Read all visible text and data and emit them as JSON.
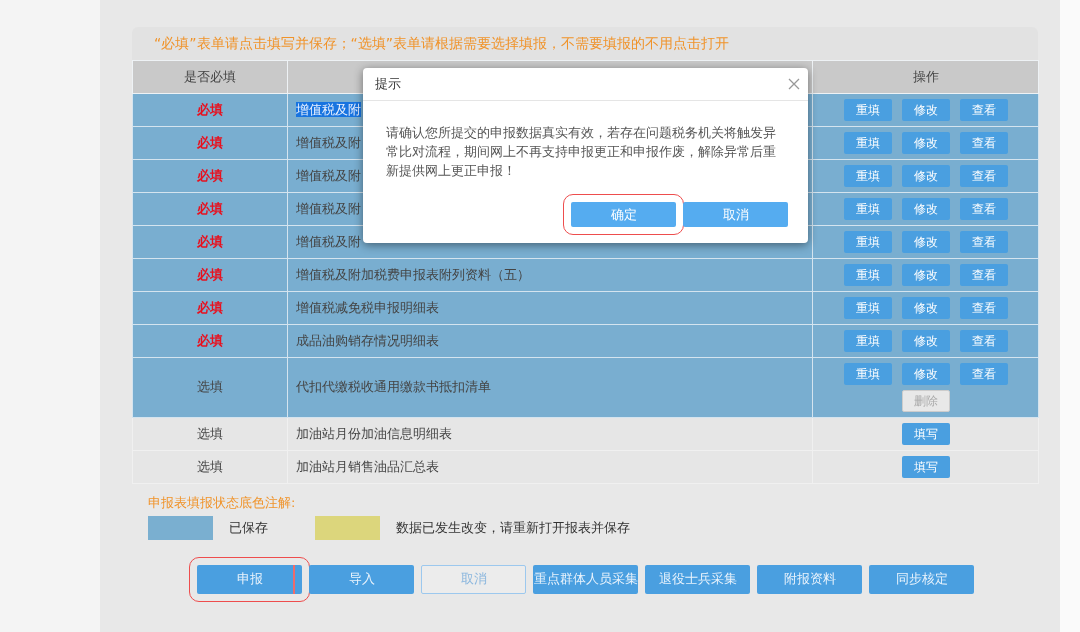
{
  "notice": "“必填”表单请点击填写并保存；“选填”表单请根据需要选择填报，不需要填报的不用点击打开",
  "table": {
    "header": {
      "column_1": "是否必填",
      "column_3": "操作"
    },
    "rows": [
      {
        "requirement": "必填",
        "kind": "required",
        "name": "增值税及附",
        "saved": true,
        "selected": true,
        "actions": [
          {
            "label": "重填",
            "disabled": false
          },
          {
            "label": "修改",
            "disabled": false
          },
          {
            "label": "查看",
            "disabled": false
          }
        ]
      },
      {
        "requirement": "必填",
        "kind": "required",
        "name": "增值税及附",
        "saved": true,
        "selected": false,
        "actions": [
          {
            "label": "重填",
            "disabled": false
          },
          {
            "label": "修改",
            "disabled": false
          },
          {
            "label": "查看",
            "disabled": false
          }
        ]
      },
      {
        "requirement": "必填",
        "kind": "required",
        "name": "增值税及附",
        "saved": true,
        "selected": false,
        "actions": [
          {
            "label": "重填",
            "disabled": false
          },
          {
            "label": "修改",
            "disabled": false
          },
          {
            "label": "查看",
            "disabled": false
          }
        ]
      },
      {
        "requirement": "必填",
        "kind": "required",
        "name": "增值税及附",
        "saved": true,
        "selected": false,
        "actions": [
          {
            "label": "重填",
            "disabled": false
          },
          {
            "label": "修改",
            "disabled": false
          },
          {
            "label": "查看",
            "disabled": false
          }
        ]
      },
      {
        "requirement": "必填",
        "kind": "required",
        "name": "增值税及附",
        "saved": true,
        "selected": false,
        "actions": [
          {
            "label": "重填",
            "disabled": false
          },
          {
            "label": "修改",
            "disabled": false
          },
          {
            "label": "查看",
            "disabled": false
          }
        ]
      },
      {
        "requirement": "必填",
        "kind": "required",
        "name": "增值税及附加税费申报表附列资料（五）",
        "saved": true,
        "selected": false,
        "actions": [
          {
            "label": "重填",
            "disabled": false
          },
          {
            "label": "修改",
            "disabled": false
          },
          {
            "label": "查看",
            "disabled": false
          }
        ]
      },
      {
        "requirement": "必填",
        "kind": "required",
        "name": "增值税减免税申报明细表",
        "saved": true,
        "selected": false,
        "actions": [
          {
            "label": "重填",
            "disabled": false
          },
          {
            "label": "修改",
            "disabled": false
          },
          {
            "label": "查看",
            "disabled": false
          }
        ]
      },
      {
        "requirement": "必填",
        "kind": "required",
        "name": "成品油购销存情况明细表",
        "saved": true,
        "selected": false,
        "actions": [
          {
            "label": "重填",
            "disabled": false
          },
          {
            "label": "修改",
            "disabled": false
          },
          {
            "label": "查看",
            "disabled": false
          }
        ]
      },
      {
        "requirement": "选填",
        "kind": "optional",
        "name": "代扣代缴税收通用缴款书抵扣清单",
        "saved": true,
        "selected": false,
        "actions": [
          {
            "label": "重填",
            "disabled": false
          },
          {
            "label": "修改",
            "disabled": false
          },
          {
            "label": "查看",
            "disabled": false
          },
          {
            "label": "删除",
            "disabled": true
          }
        ]
      },
      {
        "requirement": "选填",
        "kind": "optional",
        "name": "加油站月份加油信息明细表",
        "saved": false,
        "selected": false,
        "actions": [
          {
            "label": "填写",
            "disabled": false
          }
        ]
      },
      {
        "requirement": "选填",
        "kind": "optional",
        "name": "加油站月销售油品汇总表",
        "saved": false,
        "selected": false,
        "actions": [
          {
            "label": "填写",
            "disabled": false
          }
        ]
      }
    ]
  },
  "legend": {
    "title": "申报表填报状态底色注解:",
    "items": [
      {
        "color": "#7aafd0",
        "label": "已保存"
      },
      {
        "color": "#dcd67c",
        "label": "数据已发生改变，请重新打开报表并保存"
      }
    ]
  },
  "buttons": [
    {
      "label": "申报",
      "kind": "primary",
      "highlighted": true
    },
    {
      "label": "导入",
      "kind": "primary",
      "highlighted": false
    },
    {
      "label": "取消",
      "kind": "outline",
      "highlighted": false
    },
    {
      "label": "重点群体人员采集",
      "kind": "primary",
      "highlighted": false
    },
    {
      "label": "退役士兵采集",
      "kind": "primary",
      "highlighted": false
    },
    {
      "label": "附报资料",
      "kind": "primary",
      "highlighted": false
    },
    {
      "label": "同步核定",
      "kind": "primary",
      "highlighted": false
    }
  ],
  "dialog": {
    "title": "提示",
    "message": "请确认您所提交的申报数据真实有效，若存在问题税务机关将触发异常比对流程，期间网上不再支持申报更正和申报作废，解除异常后重新提供网上更正申报！",
    "buttons": [
      {
        "label": "确定",
        "highlighted": true
      },
      {
        "label": "取消",
        "highlighted": false
      }
    ]
  }
}
